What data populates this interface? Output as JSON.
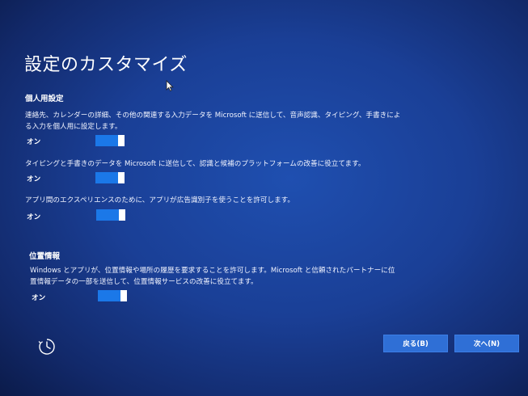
{
  "page": {
    "title": "設定のカスタマイズ"
  },
  "personalization": {
    "heading": "個人用設定",
    "items": [
      {
        "description": "連絡先、カレンダーの詳細、その他の関連する入力データを Microsoft に送信して、音声認識、タイピング、手書きによる入力を個人用に設定します。",
        "toggle_label": "オン",
        "state": "on"
      },
      {
        "description": "タイピングと手書きのデータを Microsoft に送信して、認識と候補のプラットフォームの改善に役立てます。",
        "toggle_label": "オン",
        "state": "on"
      },
      {
        "description": "アプリ間のエクスペリエンスのために、アプリが広告識別子を使うことを許可します。",
        "toggle_label": "オン",
        "state": "on"
      }
    ]
  },
  "location": {
    "heading": "位置情報",
    "description": "Windows とアプリが、位置情報や場所の履歴を要求することを許可します。Microsoft と信頼されたパートナーに位置情報データの一部を送信して、位置情報サービスの改善に役立てます。",
    "toggle_label": "オン",
    "state": "on"
  },
  "footer": {
    "ease_of_access_icon": "ease-of-access-icon",
    "back_label": "戻る(B)",
    "next_label": "次へ(N)"
  },
  "colors": {
    "background": "#1a3f96",
    "toggle_on": "#1b78e8",
    "button": "#2f6fd6"
  }
}
